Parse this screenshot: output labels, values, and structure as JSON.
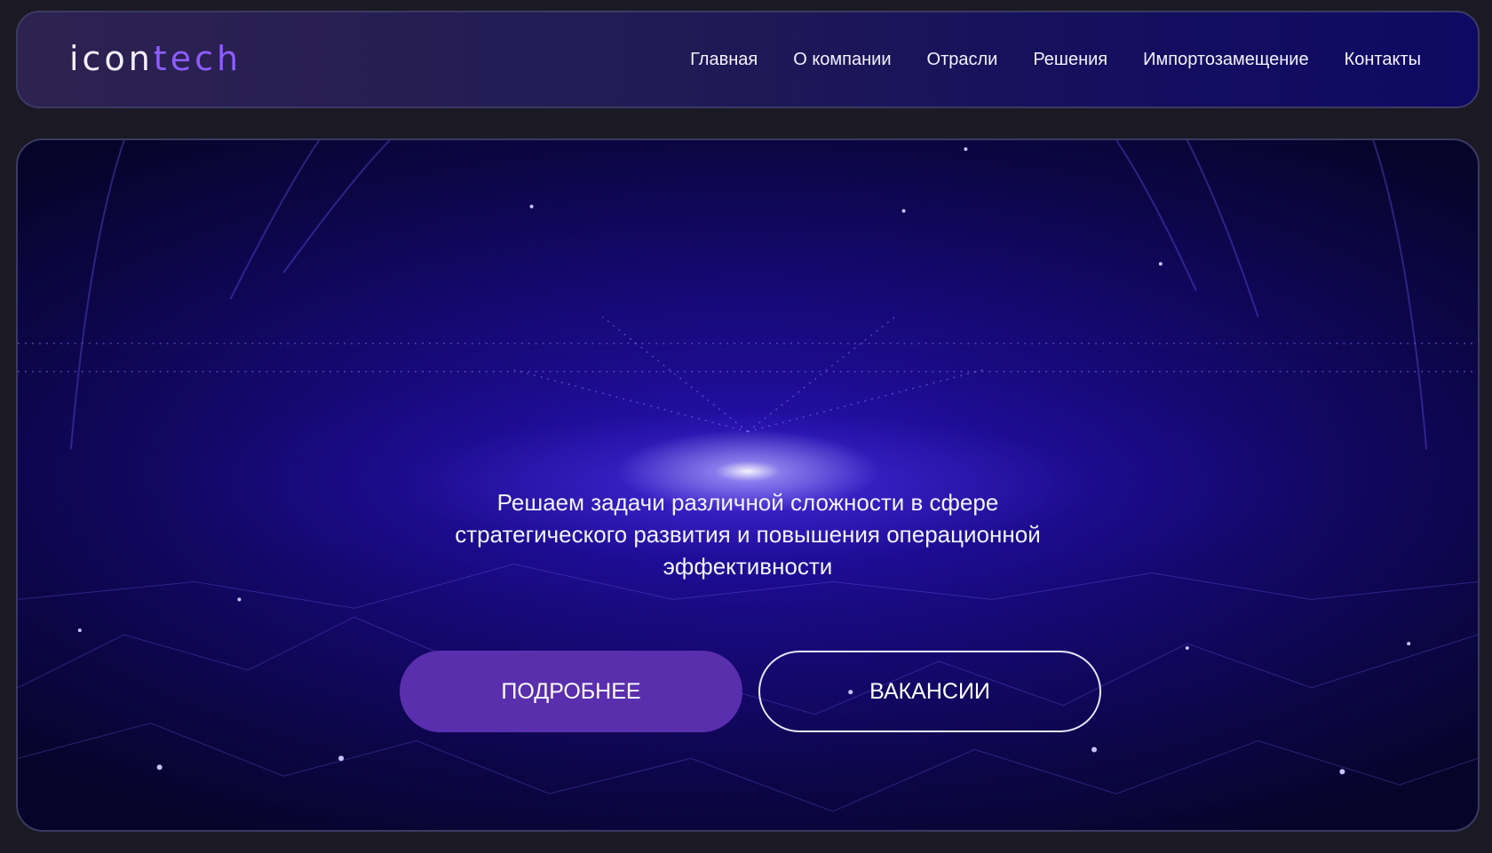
{
  "header": {
    "logo": {
      "part1": "icon",
      "part2": "tech"
    },
    "nav": [
      {
        "label": "Главная"
      },
      {
        "label": "О компании"
      },
      {
        "label": "Отрасли"
      },
      {
        "label": "Решения"
      },
      {
        "label": "Импортозамещение"
      },
      {
        "label": "Контакты"
      }
    ]
  },
  "hero": {
    "tagline": [
      "Решаем задачи различной сложности в сфере",
      "стратегического развития и повышения операционной",
      "эффективности"
    ],
    "buttons": {
      "more_label": "ПОДРОБНЕЕ",
      "jobs_label": "ВАКАНСИИ"
    }
  },
  "colors": {
    "page_bg": "#1b1923",
    "accent": "#5a2fae",
    "logo_accent": "#8d5cff",
    "text": "#f4f2ff"
  }
}
